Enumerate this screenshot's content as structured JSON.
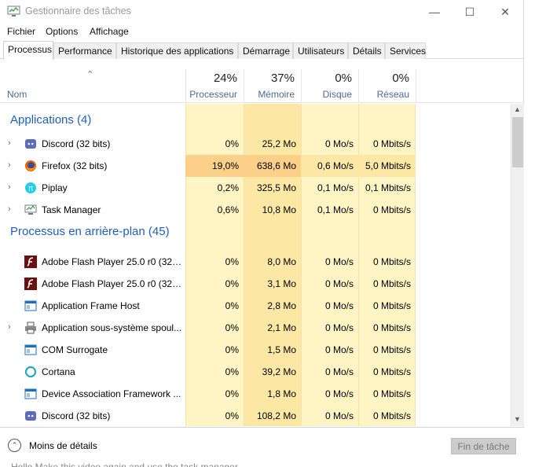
{
  "window": {
    "title": "Gestionnaire des tâches",
    "min": "—",
    "max": "☐",
    "close": "✕"
  },
  "menu": [
    "Fichier",
    "Options",
    "Affichage"
  ],
  "tabs": [
    "Processus",
    "Performance",
    "Historique des applications",
    "Démarrage",
    "Utilisateurs",
    "Détails",
    "Services"
  ],
  "header": {
    "name": "Nom",
    "cpu": {
      "pct": "24%",
      "label": "Processeur"
    },
    "mem": {
      "pct": "37%",
      "label": "Mémoire"
    },
    "disk": {
      "pct": "0%",
      "label": "Disque"
    },
    "net": {
      "pct": "0%",
      "label": "Réseau"
    }
  },
  "groups": {
    "apps": "Applications (4)",
    "background": "Processus en arrière-plan (45)"
  },
  "apps": [
    {
      "name": "Discord (32 bits)",
      "icon": "discord-icon",
      "expand": true,
      "cpu": "0%",
      "mem": "25,2 Mo",
      "disk": "0 Mo/s",
      "net": "0 Mbits/s"
    },
    {
      "name": "Firefox (32 bits)",
      "icon": "firefox-icon",
      "expand": true,
      "cpu": "19,0%",
      "mem": "638,6 Mo",
      "disk": "0,6 Mo/s",
      "net": "5,0 Mbits/s"
    },
    {
      "name": "Piplay",
      "icon": "piplay-icon",
      "expand": true,
      "cpu": "0,2%",
      "mem": "325,5 Mo",
      "disk": "0,1 Mo/s",
      "net": "0,1 Mbits/s"
    },
    {
      "name": "Task Manager",
      "icon": "task-manager-icon",
      "expand": true,
      "cpu": "0,6%",
      "mem": "10,8 Mo",
      "disk": "0,1 Mo/s",
      "net": "0 Mbits/s"
    }
  ],
  "background": [
    {
      "name": "Adobe Flash Player 25.0 r0 (32 b...",
      "icon": "flash-icon",
      "expand": false,
      "cpu": "0%",
      "mem": "8,0 Mo",
      "disk": "0 Mo/s",
      "net": "0 Mbits/s"
    },
    {
      "name": "Adobe Flash Player 25.0 r0 (32 b...",
      "icon": "flash-icon",
      "expand": false,
      "cpu": "0%",
      "mem": "3,1 Mo",
      "disk": "0 Mo/s",
      "net": "0 Mbits/s"
    },
    {
      "name": "Application Frame Host",
      "icon": "app-window-icon",
      "expand": false,
      "cpu": "0%",
      "mem": "2,8 Mo",
      "disk": "0 Mo/s",
      "net": "0 Mbits/s"
    },
    {
      "name": "Application sous-système spoul...",
      "icon": "printer-icon",
      "expand": true,
      "cpu": "0%",
      "mem": "2,1 Mo",
      "disk": "0 Mo/s",
      "net": "0 Mbits/s"
    },
    {
      "name": "COM Surrogate",
      "icon": "app-window-icon",
      "expand": false,
      "cpu": "0%",
      "mem": "1,5 Mo",
      "disk": "0 Mo/s",
      "net": "0 Mbits/s"
    },
    {
      "name": "Cortana",
      "icon": "cortana-icon",
      "expand": false,
      "cpu": "0%",
      "mem": "39,2 Mo",
      "disk": "0 Mo/s",
      "net": "0 Mbits/s"
    },
    {
      "name": "Device Association Framework ...",
      "icon": "app-window-icon",
      "expand": false,
      "cpu": "0%",
      "mem": "1,8 Mo",
      "disk": "0 Mo/s",
      "net": "0 Mbits/s"
    },
    {
      "name": "Discord (32 bits)",
      "icon": "discord-icon",
      "expand": false,
      "cpu": "0%",
      "mem": "108,2 Mo",
      "disk": "0 Mo/s",
      "net": "0 Mbits/s"
    }
  ],
  "footer": {
    "less": "Moins de détails",
    "end_task": "Fin de tâche"
  },
  "overlay_text": "Hello Make this video again and use the task manager",
  "colors": {
    "cpu_bg": "#fff4c4",
    "mem_bg": "#fde7a4",
    "cpu_hot": "#fcd089",
    "cell_bg": "#fff8d9",
    "accent": "#1f5fbd",
    "header_label": "#4d6a94"
  }
}
